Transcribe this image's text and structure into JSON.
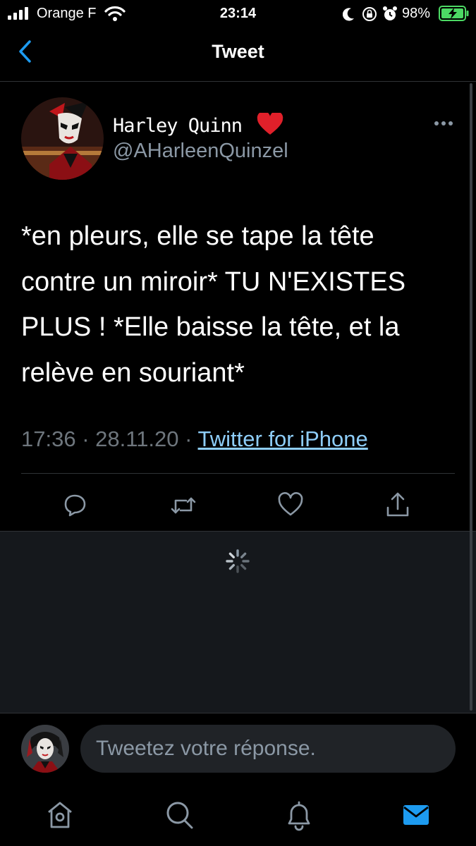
{
  "status_bar": {
    "carrier": "Orange F",
    "time": "23:14",
    "battery_percent": "98%",
    "icons": [
      "signal-icon",
      "wifi-icon",
      "moon-icon",
      "orientation-lock-icon",
      "alarm-icon",
      "battery-charging-icon"
    ]
  },
  "nav": {
    "title": "Tweet",
    "back_icon": "chevron-left-icon"
  },
  "tweet": {
    "display_name": "Harley Quinn",
    "name_emoji": "red-heart-icon",
    "handle": "@AHarleenQuinzel",
    "more_icon": "ellipsis-icon",
    "text": "*en pleurs, elle se tape la tête contre un miroir* TU N'EXISTES PLUS ! *Elle baisse la tête, et la relève en souriant*",
    "time": "17:36",
    "separator": "·",
    "date": "28.11.20",
    "source": "Twitter for iPhone"
  },
  "actions": [
    "reply-icon",
    "retweet-icon",
    "like-icon",
    "share-icon"
  ],
  "loading": {
    "icon": "spinner-icon"
  },
  "reply": {
    "placeholder": "Tweetez votre réponse."
  },
  "tab_bar": {
    "items": [
      "home-icon",
      "search-icon",
      "notifications-icon",
      "messages-icon"
    ],
    "active": "messages-icon"
  },
  "colors": {
    "accent": "#1d9bf0",
    "link": "#8ecdf8",
    "secondary_text": "#8b98a5",
    "background": "#000000",
    "loading_background": "#15181c",
    "battery_green": "#4cd964"
  }
}
